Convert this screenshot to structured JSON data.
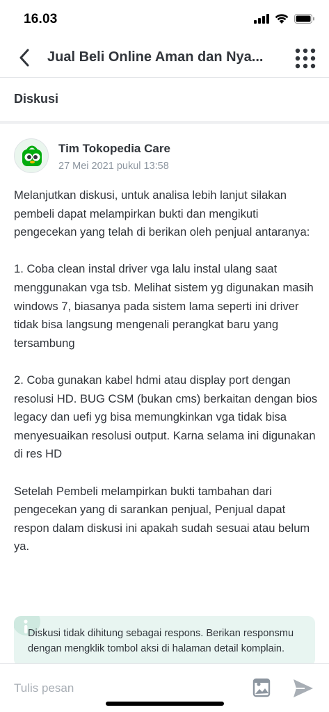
{
  "status_bar": {
    "time": "16.03"
  },
  "header": {
    "title": "Jual Beli Online Aman dan Nya..."
  },
  "section": {
    "title": "Diskusi"
  },
  "post": {
    "author": "Tim Tokopedia Care",
    "timestamp": "27 Mei 2021 pukul 13:58",
    "paragraphs": [
      "Melanjutkan diskusi, untuk analisa lebih lanjut silakan pembeli dapat melampirkan bukti dan mengikuti pengecekan yang telah di berikan oleh penjual antaranya:",
      "1. Coba clean instal driver vga lalu instal ulang saat menggunakan vga tsb. Melihat sistem yg digunakan masih windows 7, biasanya pada sistem lama seperti ini driver tidak bisa langsung mengenali perangkat baru yang tersambung",
      "2. Coba gunakan kabel hdmi atau display port dengan resolusi HD. BUG CSM (bukan cms) berkaitan dengan bios legacy dan uefi yg bisa memungkinkan vga tidak bisa menyesuaikan resolusi output. Karna selama ini digunakan di res HD",
      "Setelah Pembeli melampirkan bukti tambahan dari pengecekan yang di sarankan penjual, Penjual dapat respon dalam diskusi ini apakah sudah sesuai atau belum ya."
    ]
  },
  "info_box": {
    "text": "Diskusi tidak dihitung sebagai respons. Berikan responsmu dengan mengklik tombol aksi di halaman detail komplain."
  },
  "composer": {
    "placeholder": "Tulis pesan"
  },
  "colors": {
    "accent": "#03ac0e",
    "info_bg": "#e8f5f1",
    "text": "#31353b",
    "muted": "#8d96a0"
  },
  "icons": {
    "back": "back-arrow-icon",
    "menu": "grid-menu-icon",
    "info": "info-icon",
    "image": "image-icon",
    "send": "send-icon"
  }
}
